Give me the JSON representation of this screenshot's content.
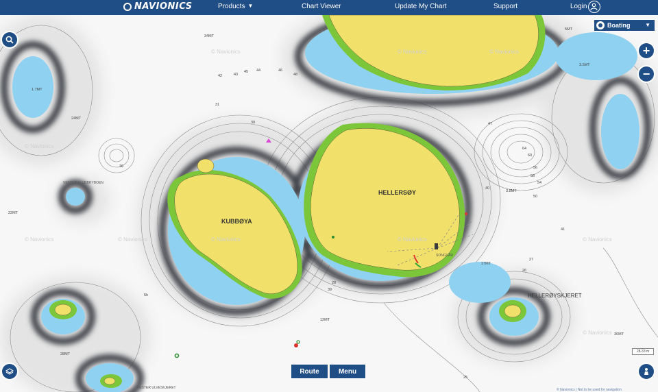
{
  "nav": {
    "logo": "NAVIONICS",
    "products": "Products",
    "chart_viewer": "Chart Viewer",
    "update_my_chart": "Update My Chart",
    "support": "Support",
    "login": "Login"
  },
  "mode_select": {
    "selected": "Boating"
  },
  "controls": {
    "route": "Route",
    "menu": "Menu"
  },
  "map": {
    "islands": [
      "HELLERSØY",
      "KUBBØYA"
    ],
    "places": [
      "HELLERØYSKJERET",
      "SONGVÅR",
      "VESTER KLUBBHYBOEN",
      "VESTER ULVESKJERET"
    ],
    "depth_labels_mt": [
      "34MT",
      "24MT",
      "22MT",
      "17MT",
      "12MT",
      "30MT",
      "28MT",
      "5MT",
      "3.5MT",
      "3.8MT",
      "1.7MT"
    ],
    "soundings": [
      "45",
      "44",
      "43",
      "46",
      "48",
      "42",
      "31",
      "30",
      "36",
      "60",
      "64",
      "56",
      "54",
      "58",
      "50",
      "40",
      "47",
      "41",
      "39",
      "28",
      "26",
      "27",
      "25",
      "5h"
    ],
    "watermark": "© Navionics",
    "scale_text": "28-33 m",
    "attribution": "© Navionics | Not to be used for navigation"
  },
  "colors": {
    "land": "#f1e06a",
    "shallow": "#8fd1f0",
    "mid_water": "#cfe6f4",
    "deep": "#f7f7f7",
    "nav_bar": "#1f4d86"
  }
}
